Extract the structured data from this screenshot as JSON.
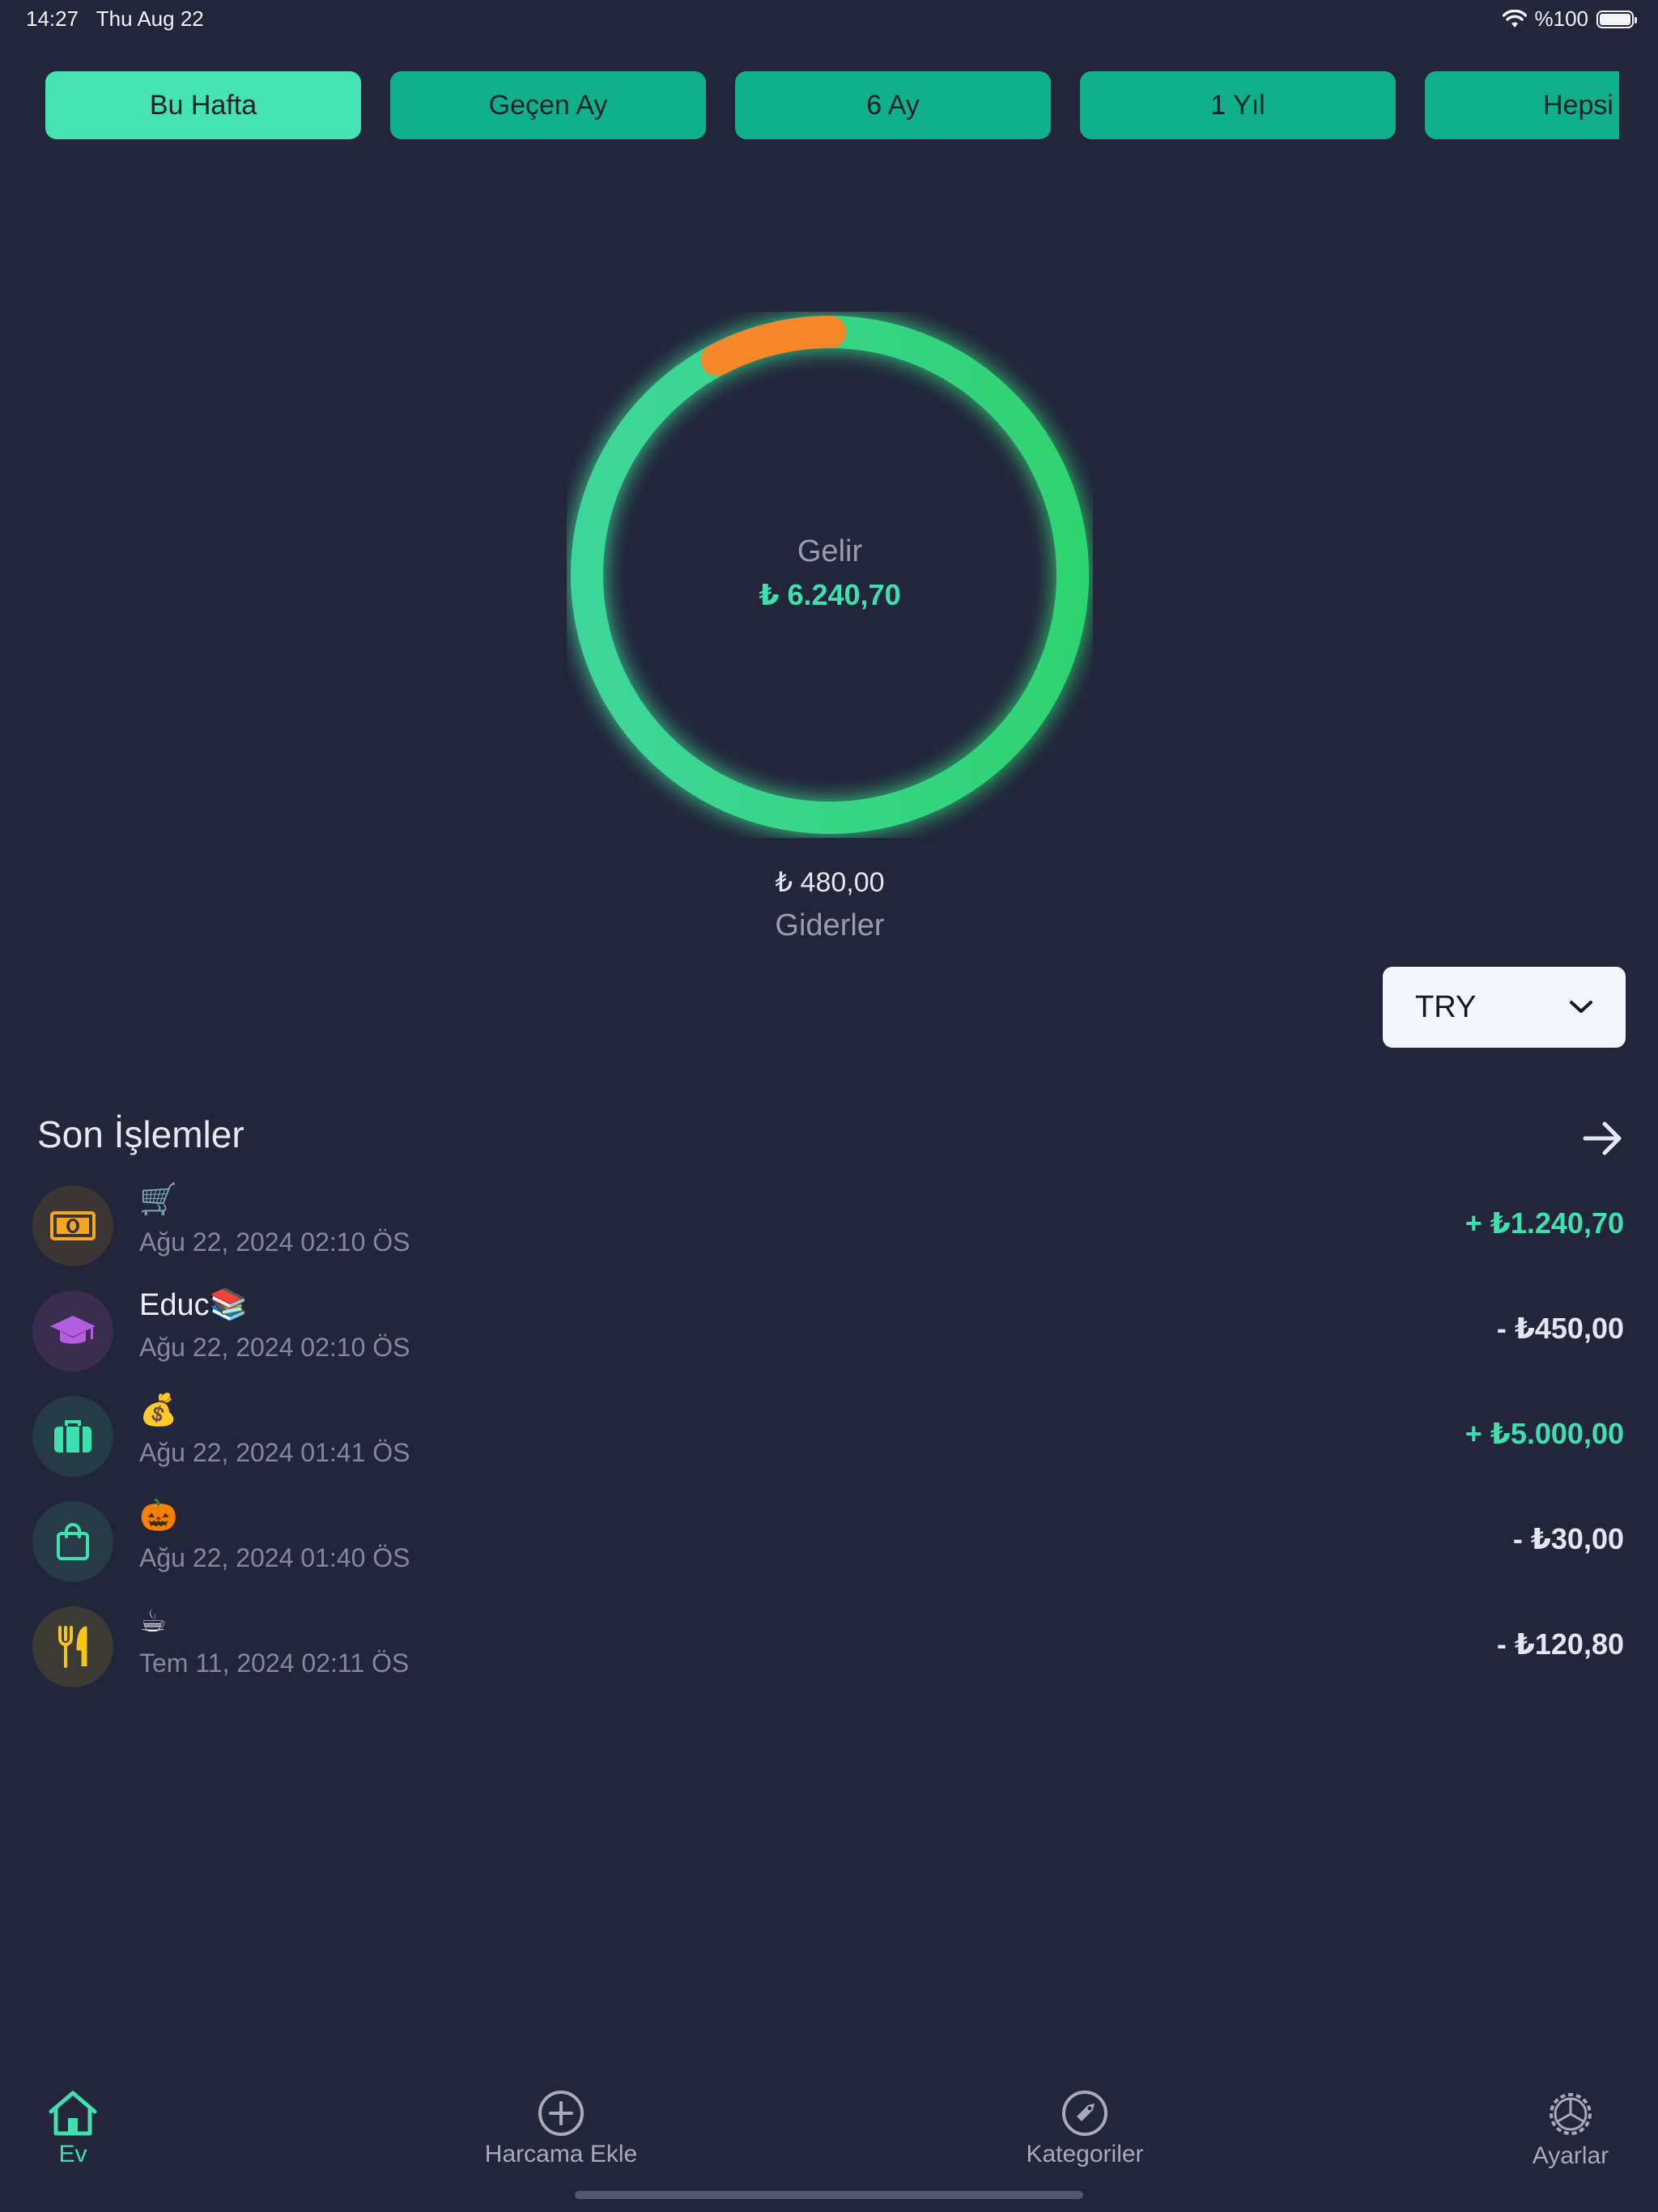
{
  "status_bar": {
    "time": "14:27",
    "date": "Thu Aug 22",
    "battery": "%100"
  },
  "periods": [
    {
      "label": "Bu Hafta",
      "active": true
    },
    {
      "label": "Geçen Ay",
      "active": false
    },
    {
      "label": "6 Ay",
      "active": false
    },
    {
      "label": "1 Yıl",
      "active": false
    },
    {
      "label": "Hepsi",
      "active": false
    }
  ],
  "summary": {
    "income_label": "Gelir",
    "income_value": "₺ 6.240,70",
    "expense_value": "₺ 480,00",
    "expense_label": "Giderler",
    "income_amount": 6240.7,
    "expense_amount": 480.0
  },
  "currency": {
    "selected": "TRY"
  },
  "recent": {
    "title": "Son İşlemler",
    "items": [
      {
        "icon": "money-icon",
        "title": "🛒",
        "date": "Ağu 22, 2024 02:10 ÖS",
        "amount": "+ ₺1.240,70",
        "positive": true
      },
      {
        "icon": "graduation-cap-icon",
        "title": "Educ📚",
        "date": "Ağu 22, 2024 02:10 ÖS",
        "amount": "- ₺450,00",
        "positive": false
      },
      {
        "icon": "briefcase-icon",
        "title": "💰",
        "date": "Ağu 22, 2024 01:41 ÖS",
        "amount": "+ ₺5.000,00",
        "positive": true
      },
      {
        "icon": "shopping-bag-icon",
        "title": "🎃",
        "date": "Ağu 22, 2024 01:40 ÖS",
        "amount": "- ₺30,00",
        "positive": false
      },
      {
        "icon": "fork-knife-icon",
        "title": "☕",
        "date": "Tem 11, 2024 02:11 ÖS",
        "amount": "- ₺120,80",
        "positive": false
      }
    ]
  },
  "tabs": [
    {
      "label": "Ev",
      "icon": "home-icon",
      "active": true
    },
    {
      "label": "Harcama Ekle",
      "icon": "plus-circle-icon",
      "active": false
    },
    {
      "label": "Kategoriler",
      "icon": "tag-icon",
      "active": false
    },
    {
      "label": "Ayarlar",
      "icon": "gear-icon",
      "active": false
    }
  ],
  "colors": {
    "background": "#23253a",
    "accent": "#3ee0ad",
    "period_button": "#10b08a",
    "period_button_active": "#45e2b2",
    "expense_arc": "#f5862a"
  }
}
